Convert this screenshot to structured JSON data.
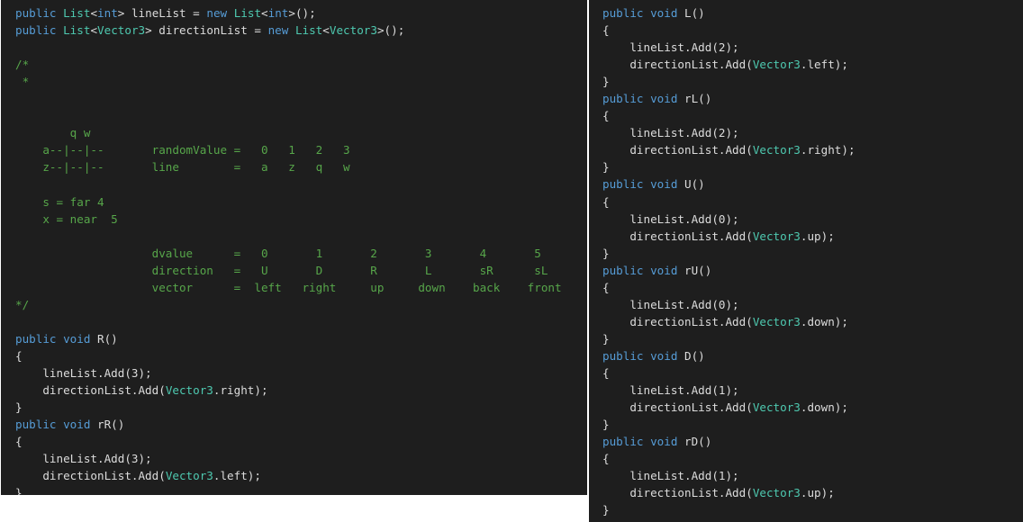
{
  "theme": {
    "background": "#1e1e1e",
    "keyword_color": "#569cd6",
    "type_color": "#4ec9b0",
    "comment_color": "#57a64a",
    "text_color": "#dcdcdc"
  },
  "left_pane": {
    "lines": [
      [
        {
          "t": "kw",
          "s": "public"
        },
        {
          "t": "plain",
          "s": " "
        },
        {
          "t": "type",
          "s": "List"
        },
        {
          "t": "plain",
          "s": "<"
        },
        {
          "t": "kw",
          "s": "int"
        },
        {
          "t": "plain",
          "s": "> lineList = "
        },
        {
          "t": "kw",
          "s": "new"
        },
        {
          "t": "plain",
          "s": " "
        },
        {
          "t": "type",
          "s": "List"
        },
        {
          "t": "plain",
          "s": "<"
        },
        {
          "t": "kw",
          "s": "int"
        },
        {
          "t": "plain",
          "s": ">();"
        }
      ],
      [
        {
          "t": "kw",
          "s": "public"
        },
        {
          "t": "plain",
          "s": " "
        },
        {
          "t": "type",
          "s": "List"
        },
        {
          "t": "plain",
          "s": "<"
        },
        {
          "t": "type",
          "s": "Vector3"
        },
        {
          "t": "plain",
          "s": "> directionList = "
        },
        {
          "t": "kw",
          "s": "new"
        },
        {
          "t": "plain",
          "s": " "
        },
        {
          "t": "type",
          "s": "List"
        },
        {
          "t": "plain",
          "s": "<"
        },
        {
          "t": "type",
          "s": "Vector3"
        },
        {
          "t": "plain",
          "s": ">();"
        }
      ],
      [],
      [
        {
          "t": "comment",
          "s": "/*"
        }
      ],
      [
        {
          "t": "comment",
          "s": " *"
        }
      ],
      [],
      [
        {
          "t": "comment",
          "s": ""
        }
      ],
      [
        {
          "t": "comment",
          "s": "        q w"
        }
      ],
      [
        {
          "t": "comment",
          "s": "    a--|--|--       randomValue =   0   1   2   3"
        }
      ],
      [
        {
          "t": "comment",
          "s": "    z--|--|--       line        =   a   z   q   w"
        }
      ],
      [
        {
          "t": "comment",
          "s": ""
        }
      ],
      [
        {
          "t": "comment",
          "s": "    s = far 4"
        }
      ],
      [
        {
          "t": "comment",
          "s": "    x = near  5"
        }
      ],
      [
        {
          "t": "comment",
          "s": ""
        }
      ],
      [
        {
          "t": "comment",
          "s": "                    dvalue      =   0       1       2       3       4       5"
        }
      ],
      [
        {
          "t": "comment",
          "s": "                    direction   =   U       D       R       L       sR      sL"
        }
      ],
      [
        {
          "t": "comment",
          "s": "                    vector      =  left   right     up     down    back    front"
        }
      ],
      [
        {
          "t": "comment",
          "s": "*/"
        }
      ],
      [],
      [
        {
          "t": "kw",
          "s": "public"
        },
        {
          "t": "plain",
          "s": " "
        },
        {
          "t": "kw",
          "s": "void"
        },
        {
          "t": "plain",
          "s": " R()"
        }
      ],
      [
        {
          "t": "plain",
          "s": "{"
        }
      ],
      [
        {
          "t": "plain",
          "s": "    lineList.Add(3);"
        }
      ],
      [
        {
          "t": "plain",
          "s": "    directionList.Add("
        },
        {
          "t": "type",
          "s": "Vector3"
        },
        {
          "t": "plain",
          "s": ".right);"
        }
      ],
      [
        {
          "t": "plain",
          "s": "}"
        }
      ],
      [
        {
          "t": "kw",
          "s": "public"
        },
        {
          "t": "plain",
          "s": " "
        },
        {
          "t": "kw",
          "s": "void"
        },
        {
          "t": "plain",
          "s": " rR()"
        }
      ],
      [
        {
          "t": "plain",
          "s": "{"
        }
      ],
      [
        {
          "t": "plain",
          "s": "    lineList.Add(3);"
        }
      ],
      [
        {
          "t": "plain",
          "s": "    directionList.Add("
        },
        {
          "t": "type",
          "s": "Vector3"
        },
        {
          "t": "plain",
          "s": ".left);"
        }
      ],
      [
        {
          "t": "plain",
          "s": "}"
        }
      ]
    ]
  },
  "right_pane": {
    "lines": [
      [
        {
          "t": "kw",
          "s": "public"
        },
        {
          "t": "plain",
          "s": " "
        },
        {
          "t": "kw",
          "s": "void"
        },
        {
          "t": "plain",
          "s": " L()"
        }
      ],
      [
        {
          "t": "plain",
          "s": "{"
        }
      ],
      [
        {
          "t": "plain",
          "s": "    lineList.Add(2);"
        }
      ],
      [
        {
          "t": "plain",
          "s": "    directionList.Add("
        },
        {
          "t": "type",
          "s": "Vector3"
        },
        {
          "t": "plain",
          "s": ".left);"
        }
      ],
      [
        {
          "t": "plain",
          "s": "}"
        }
      ],
      [
        {
          "t": "kw",
          "s": "public"
        },
        {
          "t": "plain",
          "s": " "
        },
        {
          "t": "kw",
          "s": "void"
        },
        {
          "t": "plain",
          "s": " rL()"
        }
      ],
      [
        {
          "t": "plain",
          "s": "{"
        }
      ],
      [
        {
          "t": "plain",
          "s": "    lineList.Add(2);"
        }
      ],
      [
        {
          "t": "plain",
          "s": "    directionList.Add("
        },
        {
          "t": "type",
          "s": "Vector3"
        },
        {
          "t": "plain",
          "s": ".right);"
        }
      ],
      [
        {
          "t": "plain",
          "s": "}"
        }
      ],
      [
        {
          "t": "kw",
          "s": "public"
        },
        {
          "t": "plain",
          "s": " "
        },
        {
          "t": "kw",
          "s": "void"
        },
        {
          "t": "plain",
          "s": " U()"
        }
      ],
      [
        {
          "t": "plain",
          "s": "{"
        }
      ],
      [
        {
          "t": "plain",
          "s": "    lineList.Add(0);"
        }
      ],
      [
        {
          "t": "plain",
          "s": "    directionList.Add("
        },
        {
          "t": "type",
          "s": "Vector3"
        },
        {
          "t": "plain",
          "s": ".up);"
        }
      ],
      [
        {
          "t": "plain",
          "s": "}"
        }
      ],
      [
        {
          "t": "kw",
          "s": "public"
        },
        {
          "t": "plain",
          "s": " "
        },
        {
          "t": "kw",
          "s": "void"
        },
        {
          "t": "plain",
          "s": " rU()"
        }
      ],
      [
        {
          "t": "plain",
          "s": "{"
        }
      ],
      [
        {
          "t": "plain",
          "s": "    lineList.Add(0);"
        }
      ],
      [
        {
          "t": "plain",
          "s": "    directionList.Add("
        },
        {
          "t": "type",
          "s": "Vector3"
        },
        {
          "t": "plain",
          "s": ".down);"
        }
      ],
      [
        {
          "t": "plain",
          "s": "}"
        }
      ],
      [
        {
          "t": "kw",
          "s": "public"
        },
        {
          "t": "plain",
          "s": " "
        },
        {
          "t": "kw",
          "s": "void"
        },
        {
          "t": "plain",
          "s": " D()"
        }
      ],
      [
        {
          "t": "plain",
          "s": "{"
        }
      ],
      [
        {
          "t": "plain",
          "s": "    lineList.Add(1);"
        }
      ],
      [
        {
          "t": "plain",
          "s": "    directionList.Add("
        },
        {
          "t": "type",
          "s": "Vector3"
        },
        {
          "t": "plain",
          "s": ".down);"
        }
      ],
      [
        {
          "t": "plain",
          "s": "}"
        }
      ],
      [
        {
          "t": "kw",
          "s": "public"
        },
        {
          "t": "plain",
          "s": " "
        },
        {
          "t": "kw",
          "s": "void"
        },
        {
          "t": "plain",
          "s": " rD()"
        }
      ],
      [
        {
          "t": "plain",
          "s": "{"
        }
      ],
      [
        {
          "t": "plain",
          "s": "    lineList.Add(1);"
        }
      ],
      [
        {
          "t": "plain",
          "s": "    directionList.Add("
        },
        {
          "t": "type",
          "s": "Vector3"
        },
        {
          "t": "plain",
          "s": ".up);"
        }
      ],
      [
        {
          "t": "plain",
          "s": "}"
        }
      ]
    ]
  }
}
